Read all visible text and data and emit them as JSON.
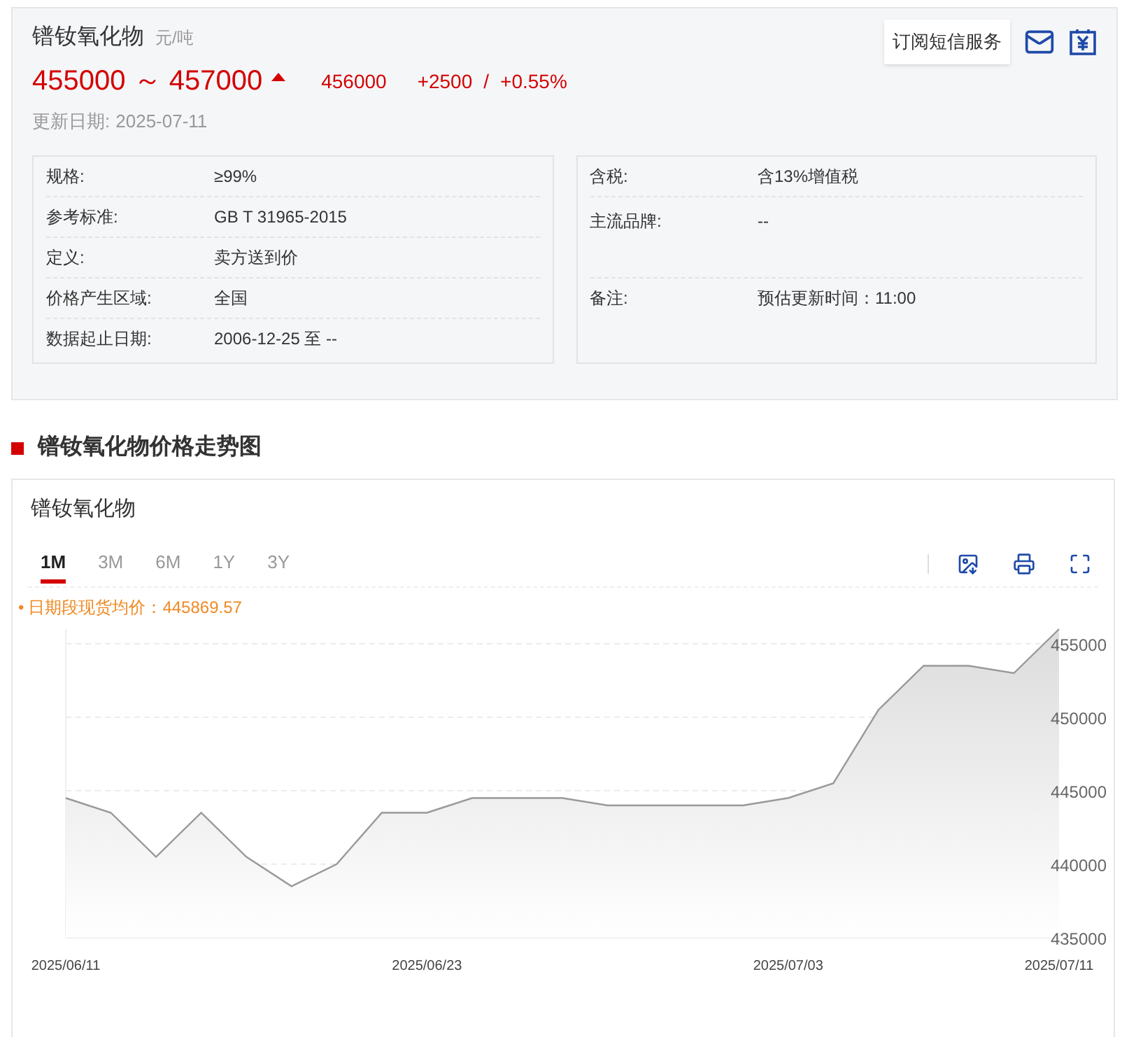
{
  "header": {
    "title": "镨钕氧化物",
    "unit": "元/吨",
    "price_range": "455000 ～ 457000",
    "rising": true,
    "average": "456000",
    "change": "+2500",
    "separator": "/",
    "change_pct": "+0.55%",
    "updated_label": "更新日期:",
    "updated": "2025-07-11",
    "subscribe_button": "订阅短信服务"
  },
  "specs_left": [
    {
      "label": "规格:",
      "value": "≥99%"
    },
    {
      "label": "参考标准:",
      "value": "GB T 31965-2015"
    },
    {
      "label": "定义:",
      "value": "卖方送到价"
    },
    {
      "label": "价格产生区域:",
      "value": "全国"
    },
    {
      "label": "数据起止日期:",
      "value": "2006-12-25 至 --"
    }
  ],
  "specs_right": [
    {
      "label": "含税:",
      "value": "含13%增值税"
    },
    {
      "label": "主流品牌:",
      "value": "--"
    },
    {
      "label": "备注:",
      "value": "预估更新时间：11:00"
    }
  ],
  "section_title": "镨钕氧化物价格走势图",
  "chart_card": {
    "title": "镨钕氧化物",
    "tabs": [
      {
        "label": "1M",
        "selected": true
      },
      {
        "label": "3M",
        "selected": false
      },
      {
        "label": "6M",
        "selected": false
      },
      {
        "label": "1Y",
        "selected": false
      },
      {
        "label": "3Y",
        "selected": false
      }
    ],
    "average_marker": "•",
    "average_note": "日期段现货均价：445869.57",
    "chart_data": {
      "type": "area",
      "categories": [
        "2025/06/11",
        null,
        null,
        null,
        null,
        null,
        null,
        null,
        "2025/06/23",
        null,
        null,
        null,
        null,
        null,
        null,
        null,
        "2025/07/03",
        null,
        null,
        null,
        null,
        null,
        "2025/07/11"
      ],
      "series": [
        {
          "color": "#999999",
          "values": [
            444500,
            443500,
            440500,
            443500,
            440500,
            438500,
            440000,
            443500,
            443500,
            444500,
            444500,
            444500,
            444000,
            444000,
            444000,
            444000,
            444500,
            445500,
            450500,
            453500,
            453500,
            453000,
            456000
          ]
        }
      ],
      "grid": true,
      "ylim": [
        435000,
        456000
      ],
      "yticks": [
        435000,
        440000,
        445000,
        450000,
        455000
      ]
    }
  }
}
